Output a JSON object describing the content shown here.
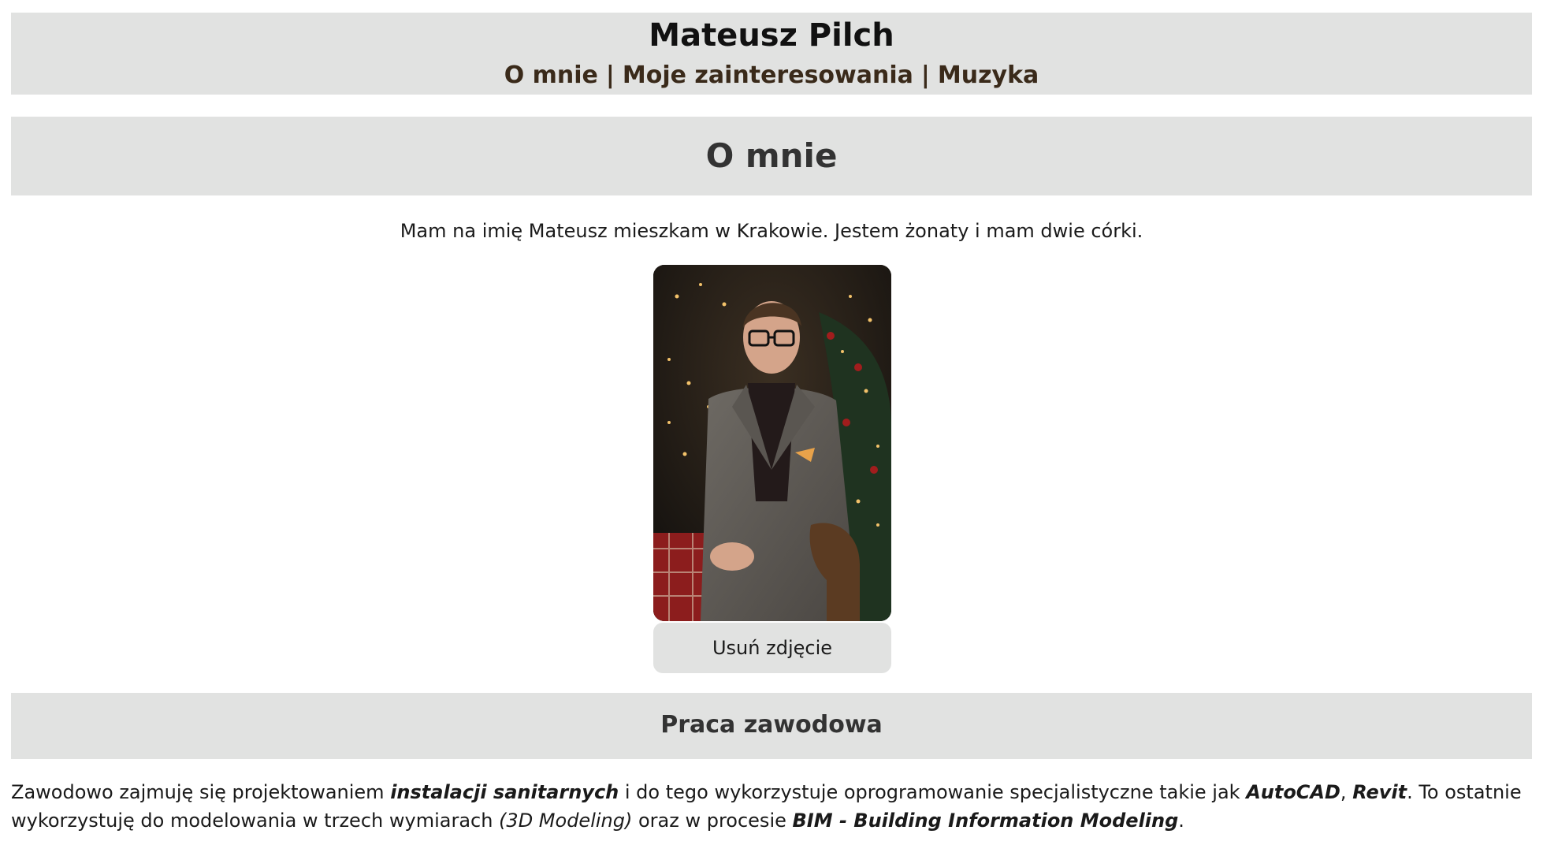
{
  "header": {
    "title": "Mateusz Pilch",
    "nav": [
      {
        "label": "O mnie"
      },
      {
        "label": "Moje zainteresowania"
      },
      {
        "label": "Muzyka"
      }
    ],
    "separator": "|"
  },
  "about": {
    "heading": "O mnie",
    "intro": "Mam na imię Mateusz mieszkam w Krakowie. Jestem żonaty i mam dwie córki.",
    "photo_icon": "portrait-photo",
    "remove_photo_label": "Usuń zdjęcie"
  },
  "work": {
    "heading": "Praca zawodowa",
    "p1": "Zawodowo zajmuję się projektowaniem ",
    "b1": "instalacji sanitarnych",
    "p2": " i do tego wykorzystuje oprogramowanie specjalistyczne takie jak ",
    "b2": "AutoCAD",
    "p3": ", ",
    "b3": "Revit",
    "p4": ". To ostatnie wykorzystuję do modelowania w trzech wymiarach ",
    "i1": "(3D Modeling)",
    "p5": " oraz w procesie ",
    "b4": "BIM - Building Information Modeling",
    "p6": "."
  },
  "colors": {
    "band": "#e1e2e1",
    "nav_text": "#3a2a1a",
    "heading_text": "#333333"
  }
}
